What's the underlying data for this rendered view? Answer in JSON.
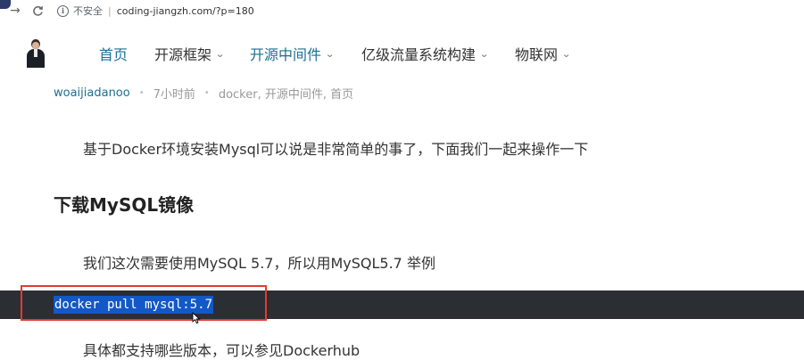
{
  "browser": {
    "back_icon": "→",
    "reload_icon": "C",
    "security_label": "不安全",
    "url": "coding-jiangzh.com/?p=180"
  },
  "nav": {
    "items": [
      {
        "label": "首页",
        "active": true,
        "has_dropdown": false
      },
      {
        "label": "开源框架",
        "active": false,
        "has_dropdown": true
      },
      {
        "label": "开源中间件",
        "active": true,
        "has_dropdown": true
      },
      {
        "label": "亿级流量系统构建",
        "active": false,
        "has_dropdown": true
      },
      {
        "label": "物联网",
        "active": false,
        "has_dropdown": true
      }
    ],
    "dropdown_glyph": "⌄"
  },
  "article": {
    "author": "woaijiadanoo",
    "time": "7小时前",
    "categories": "docker, 开源中间件, 首页",
    "intro": "基于Docker环境安装Mysql可以说是非常简单的事了，下面我们一起来操作一下",
    "heading": "下载MySQL镜像",
    "para_version": "我们这次需要使用MySQL 5.7，所以用MySQL5.7 举例",
    "code": "docker pull mysql:5.7",
    "para_more": "具体都支持哪些版本，可以参见Dockerhub"
  },
  "colors": {
    "accent": "#1b6f93",
    "code_bg": "#2b2e33",
    "selection": "#1358c7",
    "annotation_box": "#e53935"
  }
}
